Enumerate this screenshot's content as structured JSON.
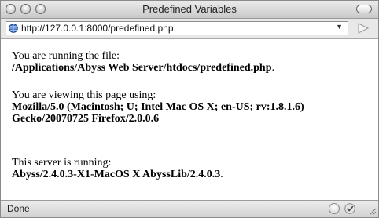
{
  "window": {
    "title": "Predefined Variables"
  },
  "address_bar": {
    "url": "http://127.0.0.1:8000/predefined.php",
    "site_icon": "globe-icon",
    "dropdown_icon": "▼",
    "go_icon": "play-triangle-icon"
  },
  "content": {
    "p1_line1": "You are running the file:",
    "p1_value": "/Applications/Abyss Web Server/htdocs/predefined.php",
    "p1_end": ".",
    "p2_line1": "You are viewing this page using:",
    "p2_value1": "Mozilla/5.0 (Macintosh; U; Intel Mac OS X; en-US; rv:1.8.1.6)",
    "p2_value2": "Gecko/20070725 Firefox/2.0.0.6",
    "p3_line1": "This server is running:",
    "p3_value": "Abyss/2.4.0.3-X1-MacOS X AbyssLib/2.4.0.3",
    "p3_end": "."
  },
  "status_bar": {
    "text": "Done"
  }
}
